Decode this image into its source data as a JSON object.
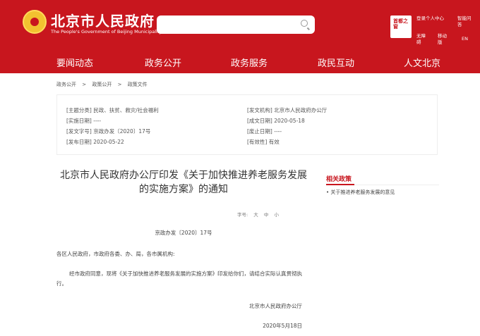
{
  "header": {
    "site_title": "北京市人民政府",
    "site_subtitle": "The People's Government of Beijing Municipality",
    "app_logo_text": "首都之窗",
    "links": {
      "login": "登录个人中心",
      "smart_qa": "智能问答",
      "accessibility": "无障碍",
      "mobile": "移动版",
      "language": "EN"
    }
  },
  "search": {
    "placeholder": ""
  },
  "nav": [
    "要闻动态",
    "政务公开",
    "政务服务",
    "政民互动",
    "人文北京"
  ],
  "breadcrumb": [
    "政务公开",
    ">",
    "政策公开",
    ">",
    "政策文件"
  ],
  "meta": {
    "subject": "[主题分类] 民政、扶贫、救灾/社会福利",
    "issuer": "[发文机构] 北京市人民政府办公厅",
    "effective_date": "[实施日期] ----",
    "written_date": "[成文日期] 2020-05-18",
    "doc_number": "[发文字号] 京政办发〔2020〕17号",
    "repeal_date": "[废止日期] ----",
    "publish_date": "[发布日期] 2020-05-22",
    "validity": "[有效性] 有效"
  },
  "article": {
    "title": "北京市人民政府办公厅印发《关于加快推进养老服务发展的实施方案》的通知",
    "font_size_label": "字号:",
    "font_sizes": [
      "大",
      "中",
      "小"
    ],
    "doc_no": "京政办发〔2020〕17号",
    "addressee": "各区人民政府，市政府各委、办、局，各市属机构:",
    "body": "经市政府同意，现将《关于加快推进养老服务发展的实施方案》印发给你们，请结合实际认真贯彻执行。",
    "sign_org": "北京市人民政府办公厅",
    "sign_date": "2020年5月18日"
  },
  "sidebar": {
    "title": "相关政策",
    "items": [
      "• 关于推进养老服务发展的意见"
    ]
  }
}
